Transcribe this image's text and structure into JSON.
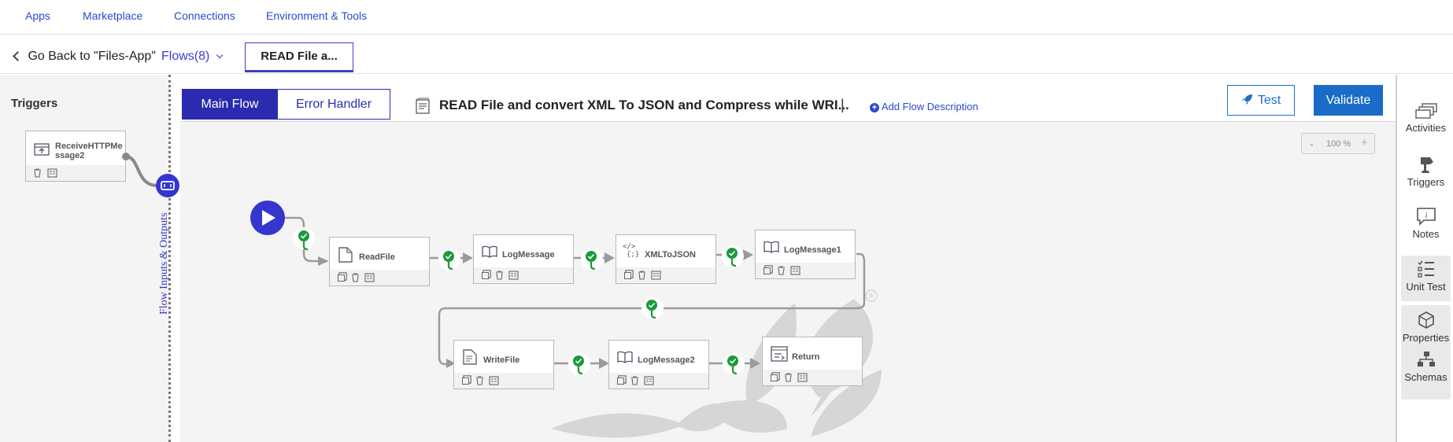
{
  "topnav": {
    "apps": "Apps",
    "marketplace": "Marketplace",
    "connections": "Connections",
    "env_tools": "Environment & Tools"
  },
  "subbar": {
    "back_label": "Go Back to \"Files-App\"",
    "flows_label": "Flows(8)",
    "flow_tab_label": "READ File a..."
  },
  "left": {
    "triggers_title": "Triggers",
    "trigger_name_line1": "ReceiveHTTPMe",
    "trigger_name_line2": "ssage2",
    "flow_io_label": "Flow Inputs & Outputs"
  },
  "header": {
    "tab_main": "Main Flow",
    "tab_error": "Error Handler",
    "flow_title": "READ File and convert XML To JSON and Compress while WRI...",
    "separator": "|",
    "add_description": "Add Flow Description",
    "test_label": "Test",
    "validate_label": "Validate",
    "zoom_minus": "-",
    "zoom_level": "100 %",
    "zoom_plus": "+"
  },
  "activities": [
    {
      "name": "ReadFile",
      "icon": "file-icon"
    },
    {
      "name": "LogMessage",
      "icon": "book-icon"
    },
    {
      "name": "XMLToJSON",
      "icon": "code-icon"
    },
    {
      "name": "LogMessage1",
      "icon": "book-icon"
    },
    {
      "name": "WriteFile",
      "icon": "file-text-icon"
    },
    {
      "name": "LogMessage2",
      "icon": "book-icon"
    },
    {
      "name": "Return",
      "icon": "return-icon"
    }
  ],
  "xml_icon_text": "</>",
  "xml_icon_text2": "{;}",
  "watermark_mark": "®",
  "rightpanel": {
    "activities": "Activities",
    "triggers": "Triggers",
    "notes": "Notes",
    "unit_test": "Unit Test",
    "properties": "Properties",
    "schemas": "Schemas"
  },
  "colors": {
    "accent": "#2b2bb0",
    "primary_button": "#1b6bc8",
    "success": "#1a9a3b",
    "start": "#3535d0"
  }
}
